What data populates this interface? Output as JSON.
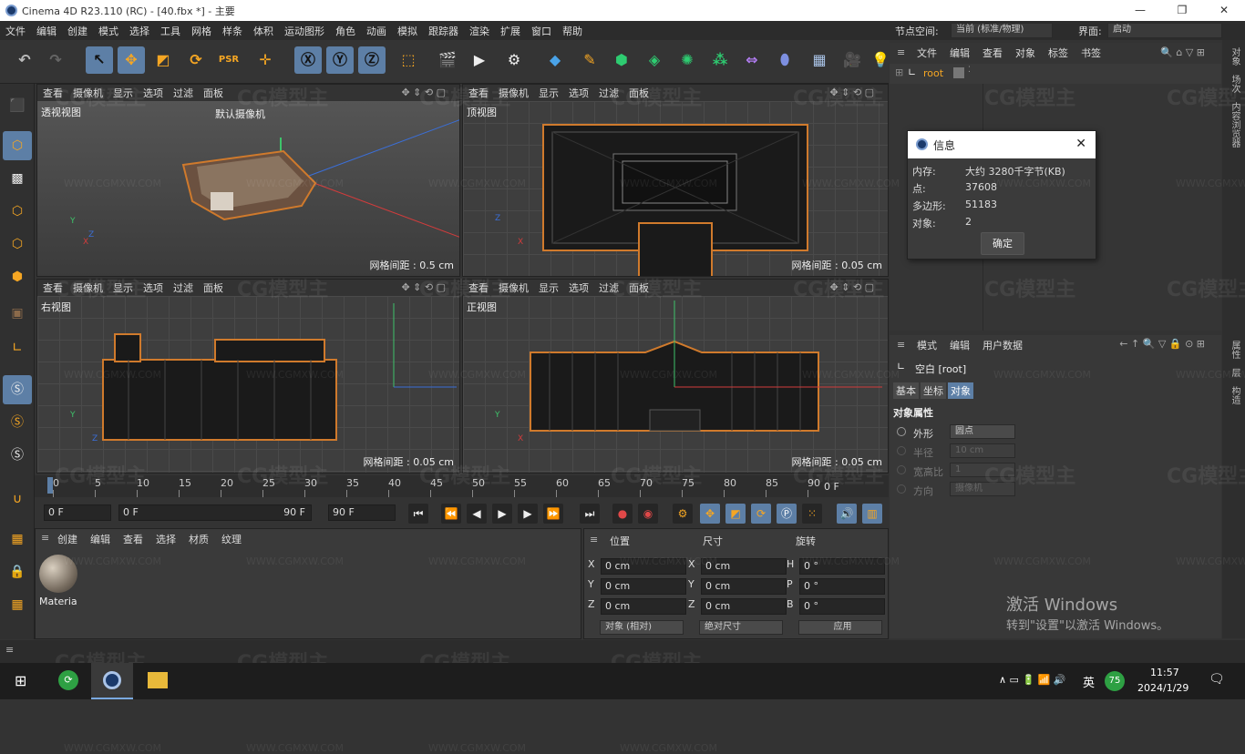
{
  "window": {
    "title": "Cinema 4D R23.110 (RC) - [40.fbx *] - 主要",
    "min": "—",
    "max": "❐",
    "close": "✕"
  },
  "menu": [
    "文件",
    "编辑",
    "创建",
    "模式",
    "选择",
    "工具",
    "网格",
    "样条",
    "体积",
    "运动图形",
    "角色",
    "动画",
    "模拟",
    "跟踪器",
    "渲染",
    "扩展",
    "窗口",
    "帮助"
  ],
  "node_space": {
    "label": "节点空间:",
    "value": "当前 (标准/物理)"
  },
  "layout": {
    "label": "界面:",
    "value": "启动"
  },
  "viewport_menu": [
    "查看",
    "摄像机",
    "显示",
    "选项",
    "过滤",
    "面板"
  ],
  "viewports": [
    {
      "name": "透视视图",
      "camera": "默认摄像机",
      "grid": "网格间距 : 0.5 cm"
    },
    {
      "name": "顶视图",
      "grid": "网格间距 : 0.05 cm"
    },
    {
      "name": "右视图",
      "grid": "网格间距 : 0.05 cm"
    },
    {
      "name": "正视图",
      "grid": "网格间距 : 0.05 cm"
    }
  ],
  "timeline": {
    "ticks": [
      "0",
      "5",
      "10",
      "15",
      "20",
      "25",
      "30",
      "35",
      "40",
      "45",
      "50",
      "55",
      "60",
      "65",
      "70",
      "75",
      "80",
      "85",
      "90"
    ],
    "end_label": "0 F"
  },
  "transport": {
    "current": "0 F",
    "range_start": "0 F",
    "range_end": "90 F",
    "max": "90 F"
  },
  "material_panel": {
    "menu": [
      "创建",
      "编辑",
      "查看",
      "选择",
      "材质",
      "纹理"
    ],
    "material_name": "Materia"
  },
  "coord_panel": {
    "headers": [
      "位置",
      "尺寸",
      "旋转"
    ],
    "rows": [
      {
        "axis": "X",
        "pos": "0 cm",
        "saxis": "X",
        "size": "0 cm",
        "raxis": "H",
        "rot": "0 °"
      },
      {
        "axis": "Y",
        "pos": "0 cm",
        "saxis": "Y",
        "size": "0 cm",
        "raxis": "P",
        "rot": "0 °"
      },
      {
        "axis": "Z",
        "pos": "0 cm",
        "saxis": "Z",
        "size": "0 cm",
        "raxis": "B",
        "rot": "0 °"
      }
    ],
    "mode": "对象 (相对)",
    "size_mode": "绝对尺寸",
    "apply": "应用"
  },
  "object_manager": {
    "menu": [
      "文件",
      "编辑",
      "查看",
      "对象",
      "标签",
      "书签"
    ],
    "root": "root"
  },
  "info_dialog": {
    "title": "信息",
    "rows": [
      {
        "label": "内存:",
        "value": "大约 3280千字节(KB)"
      },
      {
        "label": "点:",
        "value": "37608"
      },
      {
        "label": "多边形:",
        "value": "51183"
      },
      {
        "label": "对象:",
        "value": "2"
      }
    ],
    "ok": "确定"
  },
  "attr_manager": {
    "menu": [
      "模式",
      "编辑",
      "用户数据"
    ],
    "object": "空白 [root]",
    "tabs": [
      "基本",
      "坐标",
      "对象"
    ],
    "section": "对象属性",
    "props": [
      {
        "label": "外形",
        "value": "圆点"
      },
      {
        "label": "半径",
        "value": "10 cm"
      },
      {
        "label": "宽高比",
        "value": "1"
      },
      {
        "label": "方向",
        "value": "摄像机"
      }
    ]
  },
  "side_tabs_top": [
    "对象",
    "场次",
    "内容浏览器"
  ],
  "side_tabs_bottom": [
    "属性",
    "层",
    "构造"
  ],
  "activate": {
    "title": "激活 Windows",
    "sub": "转到\"设置\"以激活 Windows。"
  },
  "taskbar": {
    "time": "11:57",
    "date": "2024/1/29",
    "ime": "英",
    "badge": "75"
  },
  "watermark": {
    "logo": "CG模型主",
    "url": "WWW.CGMXW.COM"
  }
}
